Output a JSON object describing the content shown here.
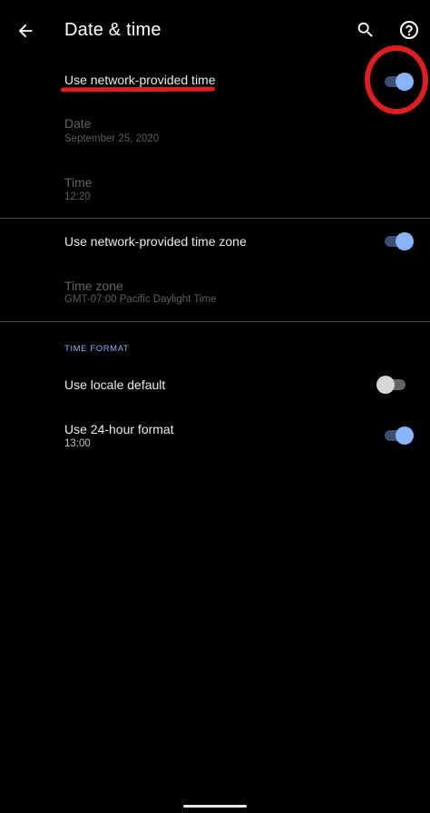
{
  "appbar": {
    "title": "Date & time",
    "back_icon": "arrow-left-icon",
    "search_icon": "search-icon",
    "help_icon": "help-icon"
  },
  "settings": {
    "network_time": {
      "label": "Use network-provided time",
      "enabled": true
    },
    "date": {
      "label": "Date",
      "value": "September 25, 2020"
    },
    "time": {
      "label": "Time",
      "value": "12:20"
    },
    "network_timezone": {
      "label": "Use network-provided time zone",
      "enabled": true
    },
    "timezone": {
      "label": "Time zone",
      "value": "GMT-07:00 Pacific Daylight Time"
    }
  },
  "time_format": {
    "header": "TIME FORMAT",
    "locale_default": {
      "label": "Use locale default",
      "enabled": false
    },
    "hour24": {
      "label": "Use 24-hour format",
      "value": "13:00",
      "enabled": true
    }
  },
  "colors": {
    "background": "#000000",
    "accent": "#8ab4f8",
    "annotation": "#e01e1e"
  }
}
